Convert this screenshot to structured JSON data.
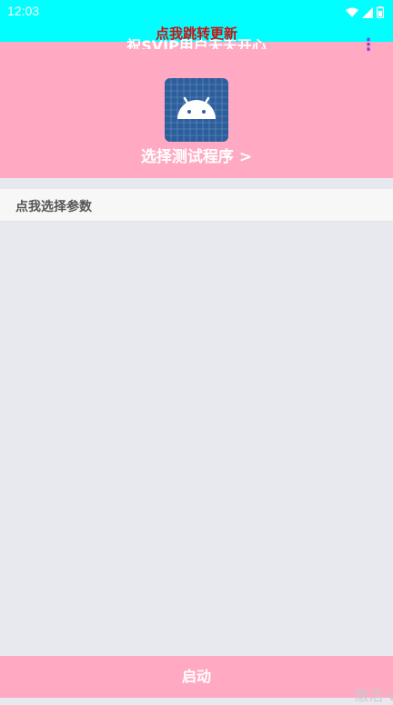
{
  "status_bar": {
    "time": "12:03",
    "icons": [
      "wifi-icon",
      "signal-icon",
      "battery-icon"
    ]
  },
  "update_banner": "点我跳转更新",
  "header": {
    "greeting": "祝SVIP用户天天开心",
    "select_program": "选择测试程序 >"
  },
  "params": {
    "label": "点我选择参数"
  },
  "start_button": "启动",
  "watermark": "激活 W",
  "colors": {
    "status_bar": "#00ffff",
    "header": "#ffaac2",
    "banner_text": "#cc1111",
    "background": "#e8e9ef",
    "app_icon": "#2d5e9c"
  }
}
